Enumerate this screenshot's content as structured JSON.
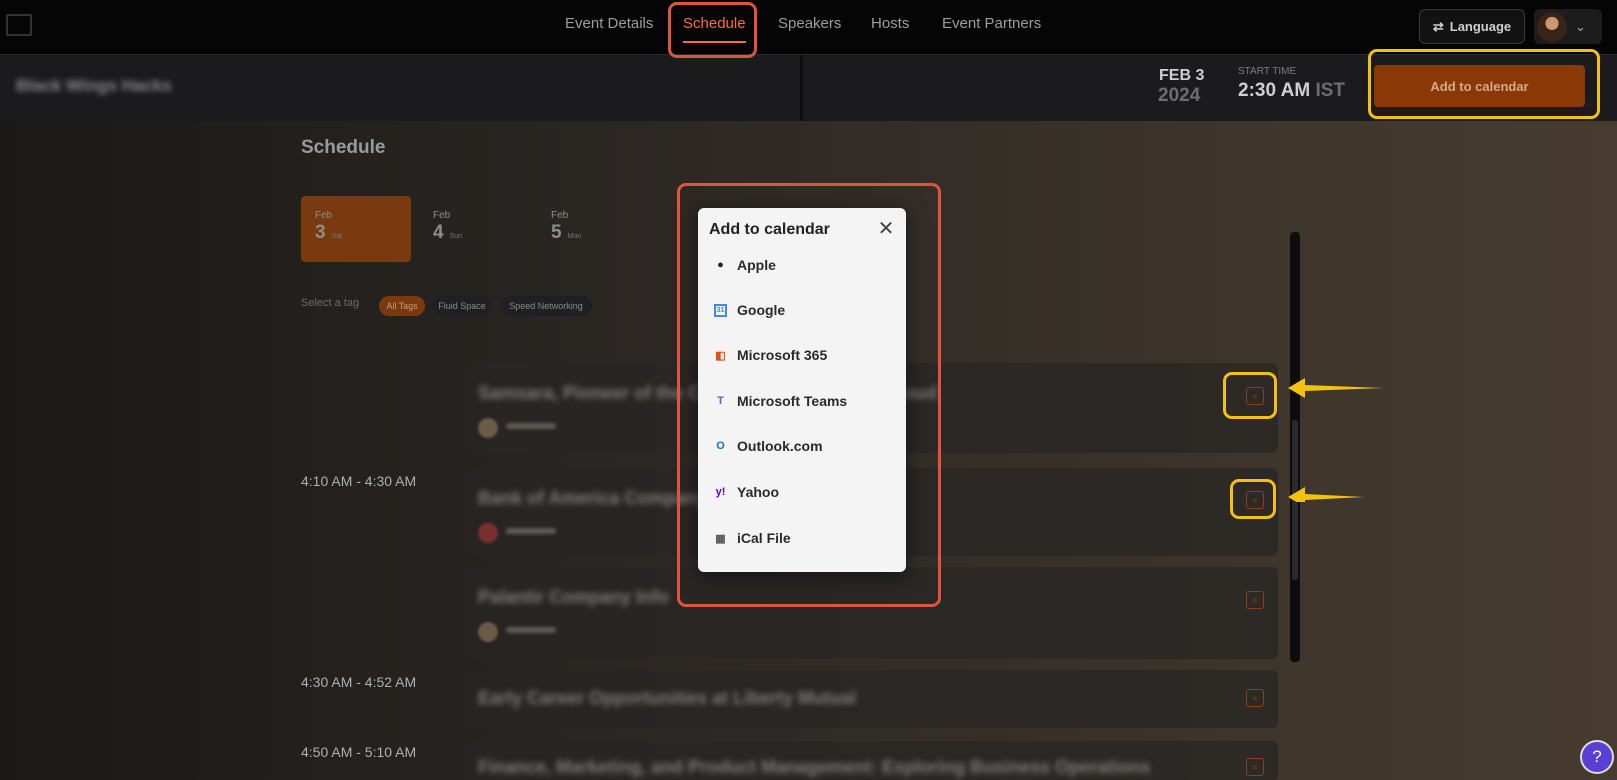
{
  "nav": {
    "tabs": [
      {
        "label": "Event Details"
      },
      {
        "label": "Schedule"
      },
      {
        "label": "Speakers"
      },
      {
        "label": "Hosts"
      },
      {
        "label": "Event Partners"
      }
    ],
    "active_tab": "Schedule",
    "language_label": "Language"
  },
  "event": {
    "name": "Black Wings Hacks",
    "date_month": "FEB 3",
    "date_year": "2024",
    "start_time_label": "START TIME",
    "start_time": "2:30 AM",
    "timezone": "IST",
    "add_to_calendar_label": "Add to calendar"
  },
  "schedule": {
    "title": "Schedule",
    "days": [
      {
        "month": "Feb",
        "day": "3",
        "weekday": "Sat",
        "active": true
      },
      {
        "month": "Feb",
        "day": "4",
        "weekday": "Sun",
        "active": false
      },
      {
        "month": "Feb",
        "day": "5",
        "weekday": "Mon",
        "active": false
      }
    ],
    "tag_label": "Select a tag",
    "tags": [
      {
        "label": "All Tags",
        "active": true
      },
      {
        "label": "Fluid Space",
        "active": false
      },
      {
        "label": "Speed Networking",
        "active": false
      }
    ],
    "timeslots": [
      "4:10 AM - 4:30 AM",
      "4:30 AM - 4:52 AM",
      "4:50 AM - 5:10 AM"
    ],
    "sessions": [
      {
        "title": "Samsara, Pioneer of the Connected Operations Cloud"
      },
      {
        "title": "Bank of America Company Info"
      },
      {
        "title": "Palantir Company Info"
      },
      {
        "title": "Early Career Opportunities at Liberty Mutual"
      },
      {
        "title": "Finance, Marketing, and Product Management: Exploring Business Operations"
      }
    ]
  },
  "calendar_modal": {
    "title": "Add to calendar",
    "options": [
      {
        "label": "Apple",
        "icon": "apple-icon",
        "color": "#222222"
      },
      {
        "label": "Google",
        "icon": "google-calendar-icon",
        "color": "#4285f4"
      },
      {
        "label": "Microsoft 365",
        "icon": "office365-icon",
        "color": "#e64a19"
      },
      {
        "label": "Microsoft Teams",
        "icon": "teams-icon",
        "color": "#5b5fc7"
      },
      {
        "label": "Outlook.com",
        "icon": "outlook-icon",
        "color": "#0a72c9"
      },
      {
        "label": "Yahoo",
        "icon": "yahoo-icon",
        "color": "#6001d2"
      },
      {
        "label": "iCal File",
        "icon": "ical-icon",
        "color": "#555555"
      }
    ]
  },
  "colors": {
    "accent": "#ff6a3d",
    "highlight_red": "#e0543f",
    "highlight_yellow": "#f4c20d"
  }
}
